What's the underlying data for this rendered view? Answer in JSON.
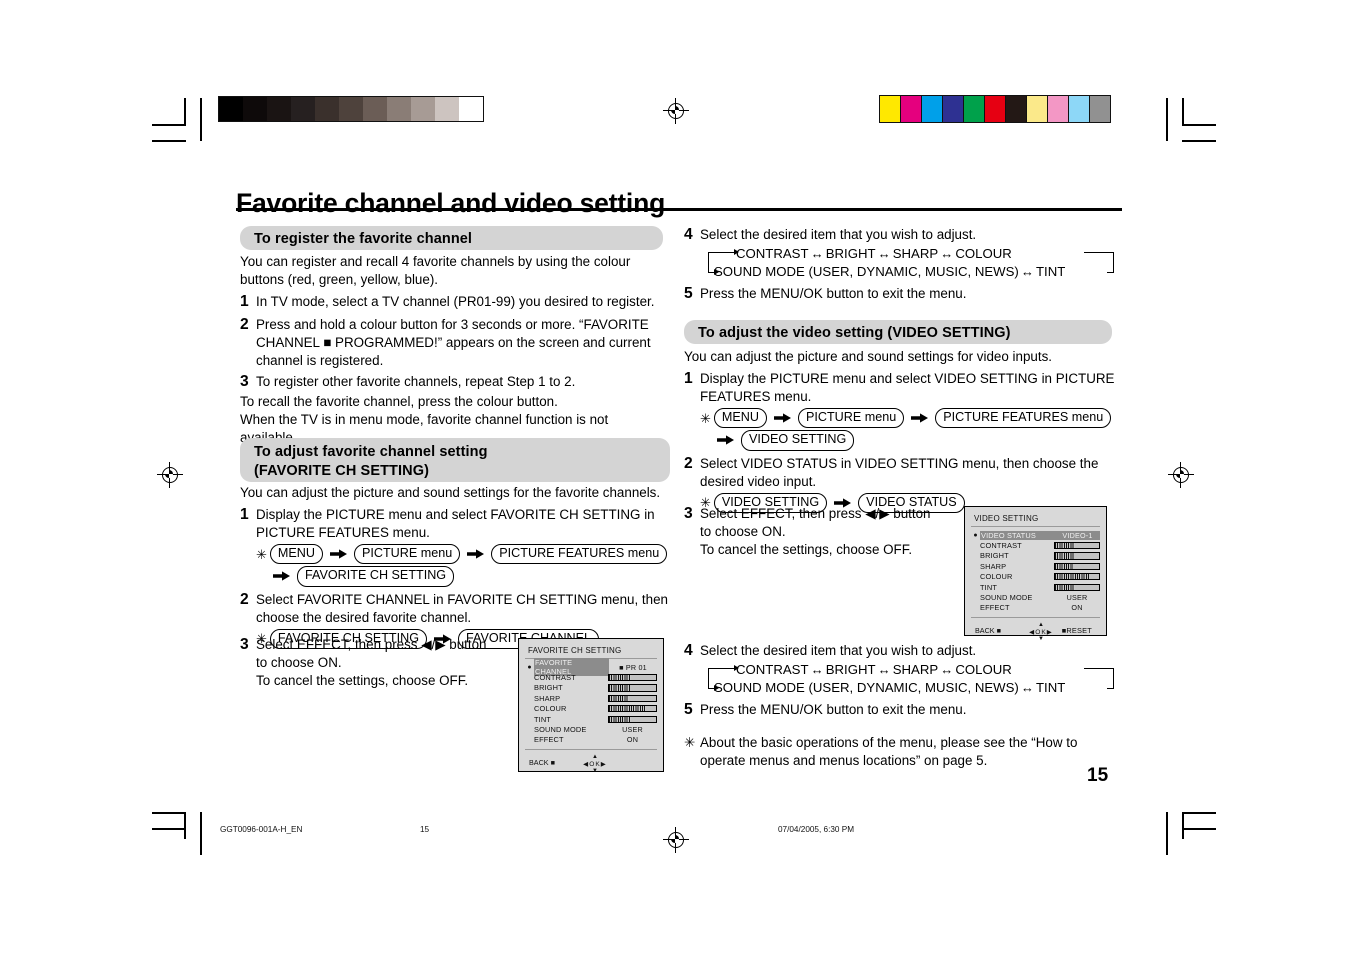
{
  "document": {
    "title": "Favorite channel and video setting",
    "page_number": "15"
  },
  "footer": {
    "file_id": "GGT0096-001A-H_EN",
    "page": "15",
    "timestamp": "07/04/2005, 6:30 PM"
  },
  "left_column": {
    "section1": {
      "heading": "To register the favorite channel",
      "intro": "You can register and recall 4 favorite channels by using the colour buttons (red, green, yellow, blue).",
      "steps": [
        {
          "num": "1",
          "text": "In TV mode, select a TV channel (PR01-99) you desired to register."
        },
        {
          "num": "2",
          "text": "Press and hold a colour button for 3 seconds or more. “FAVORITE CHANNEL ■ PROGRAMMED!” appears on the screen and current channel is registered."
        },
        {
          "num": "3",
          "text": "To register other favorite channels, repeat Step 1 to 2."
        }
      ],
      "outro": "To recall the favorite channel, press the colour button.\nWhen the TV is in menu mode, favorite channel function is not available."
    },
    "section2": {
      "heading_line1": "To adjust favorite channel setting",
      "heading_line2": "(FAVORITE CH SETTING)",
      "intro": "You can adjust the picture and sound settings for the favorite channels.",
      "step1": {
        "num": "1",
        "text": "Display the PICTURE menu and select FAVORITE CH SETTING in PICTURE FEATURES menu.",
        "chain": [
          "MENU",
          "PICTURE menu",
          "PICTURE FEATURES menu",
          "FAVORITE CH SETTING"
        ]
      },
      "step2": {
        "num": "2",
        "text": "Select FAVORITE CHANNEL in FAVORITE CH SETTING menu, then choose the desired favorite channel.",
        "chain": [
          "FAVORITE CH SETTING",
          "FAVORITE CHANNEL"
        ]
      },
      "step3": {
        "num": "3",
        "line1": "Select EFFECT, then press ◀/▶ button",
        "line2": "to choose ON.",
        "line3": "To cancel the settings, choose OFF."
      }
    },
    "osd_favorite": {
      "title": "FAVORITE CH SETTING",
      "rows": [
        {
          "label": "FAVORITE CHANNEL",
          "value": "■  PR 01",
          "type": "text",
          "highlight": true,
          "bullet": "●"
        },
        {
          "label": "CONTRAST",
          "type": "bar",
          "fill": 46
        },
        {
          "label": "BRIGHT",
          "type": "bar",
          "fill": 44
        },
        {
          "label": "SHARP",
          "type": "bar",
          "fill": 42
        },
        {
          "label": "COLOUR",
          "type": "bar",
          "fill": 78
        },
        {
          "label": "TINT",
          "type": "bar",
          "fill": 46
        },
        {
          "label": "SOUND MODE",
          "value": "USER",
          "type": "text"
        },
        {
          "label": "EFFECT",
          "value": "ON",
          "type": "text"
        }
      ],
      "nav": {
        "back": "BACK ■",
        "up": "▲",
        "left": "◀",
        "ok": "OK",
        "right": "▶",
        "down": "▼"
      }
    }
  },
  "right_column": {
    "step4_a": {
      "num": "4",
      "text": "Select the desired item that you wish to adjust.",
      "loop_row1": [
        "CONTRAST",
        "BRIGHT",
        "SHARP",
        "COLOUR"
      ],
      "loop_row2": [
        "SOUND MODE (USER, DYNAMIC, MUSIC, NEWS)",
        "TINT"
      ]
    },
    "step5_a": {
      "num": "5",
      "text": "Press the MENU/OK button to exit the menu."
    },
    "section3": {
      "heading": "To adjust the video setting (VIDEO SETTING)",
      "intro": "You can adjust the picture and sound settings for video inputs.",
      "step1": {
        "num": "1",
        "text": "Display the PICTURE menu and select VIDEO SETTING in PICTURE FEATURES menu.",
        "chain": [
          "MENU",
          "PICTURE menu",
          "PICTURE FEATURES menu",
          "VIDEO SETTING"
        ]
      },
      "step2": {
        "num": "2",
        "text": "Select VIDEO STATUS in VIDEO SETTING menu, then choose the desired video input.",
        "chain": [
          "VIDEO SETTING",
          "VIDEO STATUS"
        ]
      },
      "step3": {
        "num": "3",
        "line1": "Select EFFECT, then press ◀/▶ button",
        "line2": "to choose ON.",
        "line3": "To cancel the settings, choose OFF."
      }
    },
    "osd_video": {
      "title": "VIDEO SETTING",
      "rows": [
        {
          "label": "VIDEO STATUS",
          "value": "VIDEO-1",
          "type": "boxvalue",
          "highlight": true,
          "bullet": "●"
        },
        {
          "label": "CONTRAST",
          "type": "bar",
          "fill": 46
        },
        {
          "label": "BRIGHT",
          "type": "bar",
          "fill": 44
        },
        {
          "label": "SHARP",
          "type": "bar",
          "fill": 42
        },
        {
          "label": "COLOUR",
          "type": "bar",
          "fill": 80
        },
        {
          "label": "TINT",
          "type": "bar",
          "fill": 46
        },
        {
          "label": "SOUND MODE",
          "value": "USER",
          "type": "text"
        },
        {
          "label": "EFFECT",
          "value": "ON",
          "type": "text"
        }
      ],
      "nav": {
        "back": "BACK ■",
        "up": "▲",
        "left": "◀",
        "ok": "OK",
        "right": "▶",
        "down": "▼",
        "reset": "■RESET"
      }
    },
    "step4_b": {
      "num": "4",
      "text": "Select the desired item that you wish to adjust.",
      "loop_row1": [
        "CONTRAST",
        "BRIGHT",
        "SHARP",
        "COLOUR"
      ],
      "loop_row2": [
        "SOUND MODE (USER, DYNAMIC, MUSIC, NEWS)",
        "TINT"
      ]
    },
    "step5_b": {
      "num": "5",
      "text": "Press the MENU/OK button to exit the menu."
    },
    "note": {
      "symbol": "✳",
      "text": "About the basic operations of the menu, please see the “How to operate menus and menus locations” on page 5."
    }
  },
  "print_marks": {
    "greyscale_patches": [
      "#000000",
      "#0e0a0a",
      "#1a1413",
      "#262020",
      "#3a302c",
      "#4e423c",
      "#6b5d56",
      "#8a7d76",
      "#a79b95",
      "#cdc4c0",
      "#ffffff"
    ],
    "colour_patches": [
      "#ffe800",
      "#e5007e",
      "#00a0e9",
      "#2e3192",
      "#00a14b",
      "#e60012",
      "#231815",
      "#fbe98a",
      "#f397c5",
      "#8dd7f7",
      "#919191"
    ]
  }
}
